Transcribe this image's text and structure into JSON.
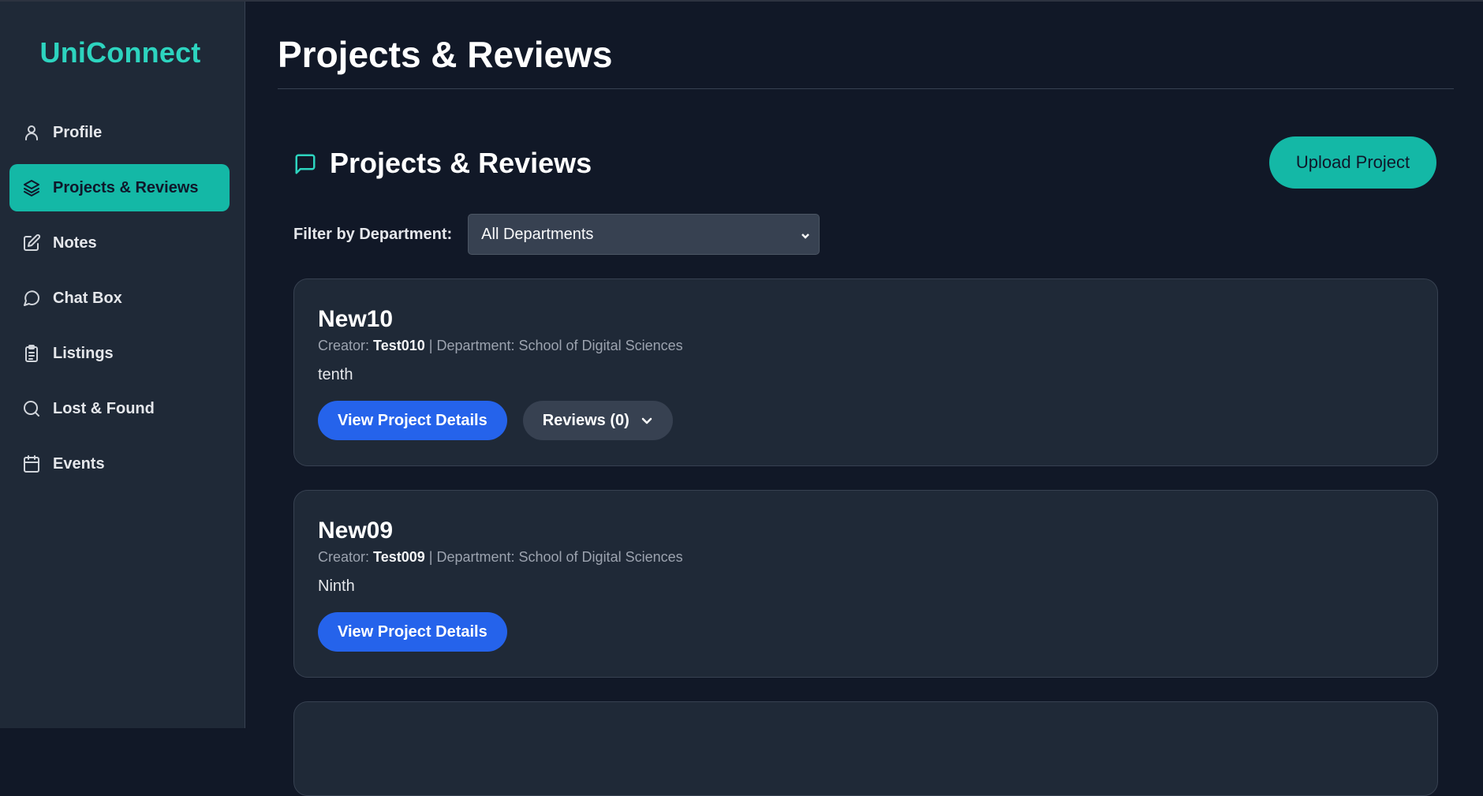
{
  "app": {
    "name": "UniConnect"
  },
  "sidebar": {
    "items": [
      {
        "label": "Profile",
        "icon": "user-icon",
        "active": false
      },
      {
        "label": "Projects & Reviews",
        "icon": "layers-icon",
        "active": true
      },
      {
        "label": "Notes",
        "icon": "edit-icon",
        "active": false
      },
      {
        "label": "Chat Box",
        "icon": "chat-icon",
        "active": false
      },
      {
        "label": "Listings",
        "icon": "clipboard-icon",
        "active": false
      },
      {
        "label": "Lost & Found",
        "icon": "search-icon",
        "active": false
      },
      {
        "label": "Events",
        "icon": "calendar-icon",
        "active": false
      }
    ]
  },
  "page": {
    "title": "Projects & Reviews"
  },
  "section": {
    "title": "Projects & Reviews",
    "icon": "message-square-icon",
    "upload_label": "Upload Project"
  },
  "filter": {
    "label": "Filter by Department:",
    "selected": "All Departments"
  },
  "projects": [
    {
      "title": "New10",
      "creator_label": "Creator:",
      "creator": "Test010",
      "department_text": "| Department: School of Digital Sciences",
      "description": "tenth",
      "view_label": "View Project Details",
      "reviews_label": "Reviews (0)"
    },
    {
      "title": "New09",
      "creator_label": "Creator:",
      "creator": "Test009",
      "department_text": "| Department: School of Digital Sciences",
      "description": "Ninth",
      "view_label": "View Project Details"
    }
  ],
  "colors": {
    "background": "#111827",
    "sidebar": "#1f2937",
    "accent": "#14b8a6",
    "logo": "#2dd4bf",
    "primary_button": "#2563eb",
    "secondary_button": "#374151"
  }
}
